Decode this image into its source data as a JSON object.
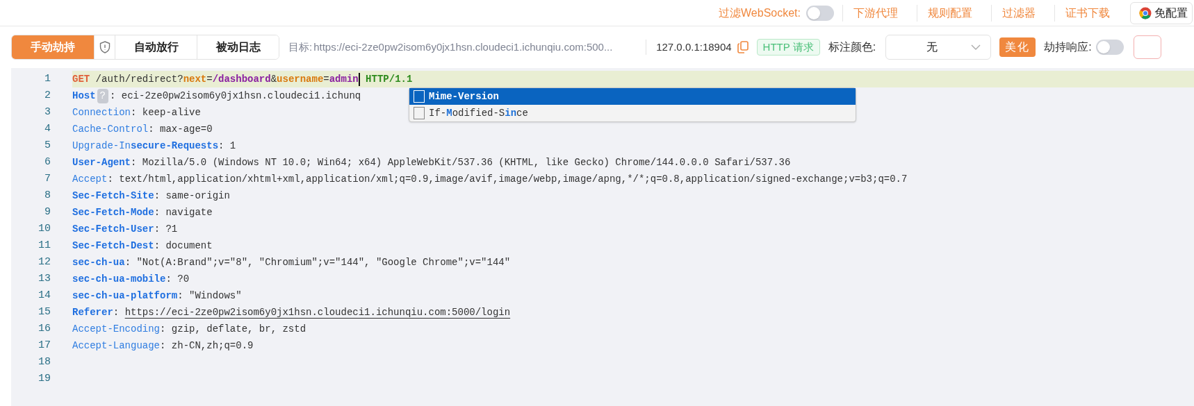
{
  "top_bar": {
    "websocket_filter": {
      "label": "过滤WebSocket:",
      "on": false
    },
    "links": [
      "下游代理",
      "规则配置",
      "过滤器",
      "证书下载"
    ],
    "browser_button": "免配置"
  },
  "toolbar": {
    "modes": [
      {
        "label": "手动劫持",
        "selected": true
      },
      {
        "label": "自动放行",
        "selected": false
      },
      {
        "label": "被动日志",
        "selected": false
      }
    ],
    "target_label": "目标:",
    "target_url": "https://eci-2ze0pw2isom6y0jx1hsn.cloudeci1.ichunqiu.com:500...",
    "address": "127.0.0.1:18904",
    "protocol_badge": "HTTP 请求",
    "color_label": "标注颜色:",
    "color_value": "无",
    "beautify_button": "美化",
    "hijack_response": {
      "label": "劫持响应:",
      "on": false
    }
  },
  "editor": {
    "lines": [
      {
        "number": "1",
        "current": true,
        "tokens": [
          {
            "kind": "method",
            "text": "GET"
          },
          {
            "kind": "plain",
            "text": " /auth/redirect?"
          },
          {
            "kind": "param",
            "text": "next"
          },
          {
            "kind": "plain",
            "text": "="
          },
          {
            "kind": "value",
            "text": "/dashboard"
          },
          {
            "kind": "plain",
            "text": "&"
          },
          {
            "kind": "param",
            "text": "username"
          },
          {
            "kind": "plain",
            "text": "="
          },
          {
            "kind": "value",
            "text": "admin",
            "cursor": true
          },
          {
            "kind": "version",
            "text": " HTTP/1.1"
          }
        ]
      },
      {
        "number": "2",
        "current": false,
        "tokens": [
          {
            "kind": "name-bold",
            "text": "Host"
          },
          {
            "kind": "badge",
            "text": "?"
          },
          {
            "kind": "plain",
            "text": ": eci-2ze0pw2isom6y0jx1hsn.cloudeci1.ichunq"
          }
        ]
      },
      {
        "number": "3",
        "current": false,
        "tokens": [
          {
            "kind": "name",
            "text": "Connection"
          },
          {
            "kind": "plain",
            "text": ": keep-alive"
          }
        ]
      },
      {
        "number": "4",
        "current": false,
        "tokens": [
          {
            "kind": "name",
            "text": "Cache-Control"
          },
          {
            "kind": "plain",
            "text": ": max-age=0"
          }
        ]
      },
      {
        "number": "5",
        "current": false,
        "tokens": [
          {
            "kind": "name",
            "text": "Upgrade-In"
          },
          {
            "kind": "name-bold",
            "text": "secure-Requests"
          },
          {
            "kind": "plain",
            "text": ": 1"
          }
        ]
      },
      {
        "number": "6",
        "current": false,
        "tokens": [
          {
            "kind": "name-bold",
            "text": "User-Agent"
          },
          {
            "kind": "plain",
            "text": ": Mozilla/5.0 (Windows NT 10.0; Win64; x64) AppleWebKit/537.36 (KHTML, like Gecko) Chrome/144.0.0.0 Safari/537.36"
          }
        ]
      },
      {
        "number": "7",
        "current": false,
        "tokens": [
          {
            "kind": "name",
            "text": "Accept"
          },
          {
            "kind": "plain",
            "text": ": text/html,application/xhtml+xml,application/xml;q=0.9,image/avif,image/webp,image/apng,*/*;q=0.8,application/signed-exchange;v=b3;q=0.7"
          }
        ]
      },
      {
        "number": "8",
        "current": false,
        "tokens": [
          {
            "kind": "name-bold",
            "text": "Sec-Fetch-Site"
          },
          {
            "kind": "plain",
            "text": ": same-origin"
          }
        ]
      },
      {
        "number": "9",
        "current": false,
        "tokens": [
          {
            "kind": "name-bold",
            "text": "Sec-Fetch-Mode"
          },
          {
            "kind": "plain",
            "text": ": navigate"
          }
        ]
      },
      {
        "number": "10",
        "current": false,
        "tokens": [
          {
            "kind": "name-bold",
            "text": "Sec-Fetch-User"
          },
          {
            "kind": "plain",
            "text": ": ?1"
          }
        ]
      },
      {
        "number": "11",
        "current": false,
        "tokens": [
          {
            "kind": "name-bold",
            "text": "Sec-Fetch-Dest"
          },
          {
            "kind": "plain",
            "text": ": document"
          }
        ]
      },
      {
        "number": "12",
        "current": false,
        "tokens": [
          {
            "kind": "name-bold",
            "text": "sec-ch-ua"
          },
          {
            "kind": "plain",
            "text": ": \"Not(A:Brand\";v=\"8\", \"Chromium\";v=\"144\", \"Google Chrome\";v=\"144\""
          }
        ]
      },
      {
        "number": "13",
        "current": false,
        "tokens": [
          {
            "kind": "name-bold",
            "text": "sec-ch-ua-mobile"
          },
          {
            "kind": "plain",
            "text": ": ?0"
          }
        ]
      },
      {
        "number": "14",
        "current": false,
        "tokens": [
          {
            "kind": "name-bold",
            "text": "sec-ch-ua-platform"
          },
          {
            "kind": "plain",
            "text": ": \"Windows\""
          }
        ]
      },
      {
        "number": "15",
        "current": false,
        "tokens": [
          {
            "kind": "name-bold",
            "text": "Referer"
          },
          {
            "kind": "plain",
            "text": ": "
          },
          {
            "kind": "link",
            "text": "https://eci-2ze0pw2isom6y0jx1hsn.cloudeci1.ichunqiu.com:5000/login"
          }
        ]
      },
      {
        "number": "16",
        "current": false,
        "tokens": [
          {
            "kind": "name",
            "text": "Accept-Encoding"
          },
          {
            "kind": "plain",
            "text": ": gzip, deflate, br, zstd"
          }
        ]
      },
      {
        "number": "17",
        "current": false,
        "tokens": [
          {
            "kind": "name",
            "text": "Accept-Language"
          },
          {
            "kind": "plain",
            "text": ": zh-CN,zh;q=0.9"
          }
        ]
      },
      {
        "number": "18",
        "current": false
      },
      {
        "number": "19",
        "current": false
      }
    ],
    "suggestions": [
      {
        "text": "Mime-Version",
        "selected": true
      },
      {
        "text": "If-**M**odified-S**in**ce",
        "selected": false
      }
    ]
  }
}
